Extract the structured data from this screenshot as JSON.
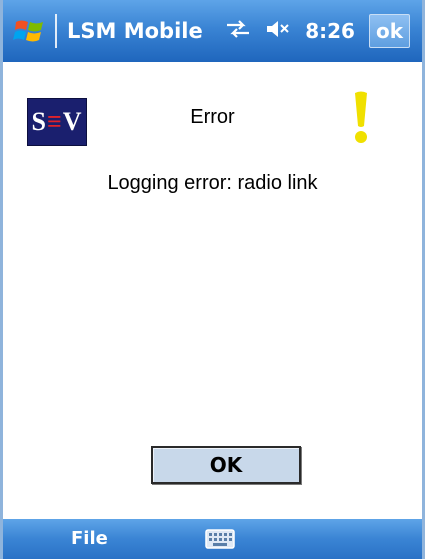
{
  "titlebar": {
    "app_title": "LSM Mobile",
    "clock": "8:26",
    "ok_label": "ok",
    "icons": [
      "windows-start-icon",
      "connectivity-icon",
      "speaker-muted-icon"
    ]
  },
  "dialog": {
    "logo_text": {
      "left": "S",
      "middle": "≡",
      "right": "V"
    },
    "title": "Error",
    "message": "Logging error: radio link",
    "ok_label": "OK",
    "icon": "warning-exclamation-icon"
  },
  "menubar": {
    "file_label": "File",
    "keyboard_icon": "keyboard-icon"
  },
  "colors": {
    "titlebar": "#3a84d4",
    "logo_bg": "#1a1f6e",
    "logo_accent": "#e0222a",
    "warning": "#f0e000",
    "button_bg": "#c8d8ea"
  }
}
